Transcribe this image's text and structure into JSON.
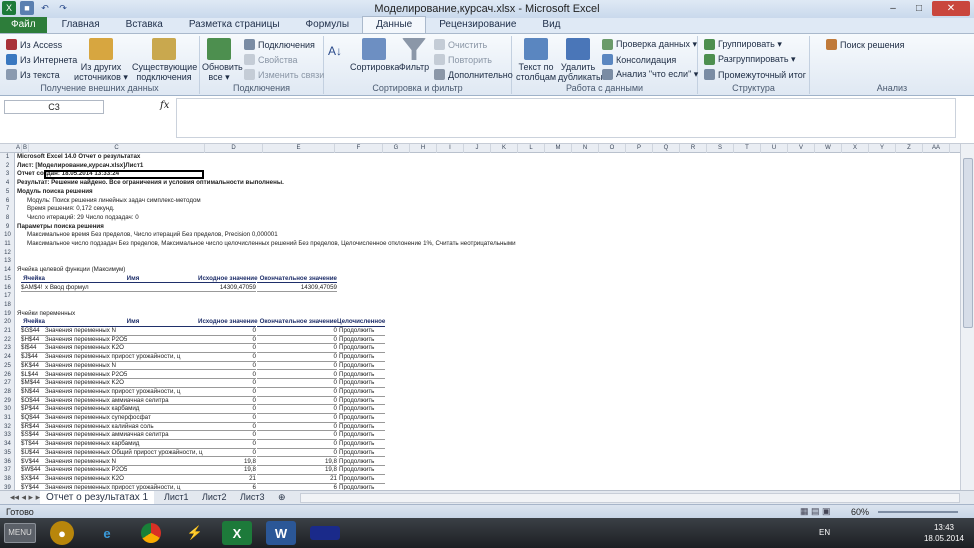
{
  "window": {
    "title": "Моделирование,курсач.xlsx  -  Microsoft Excel",
    "minimize": "–",
    "maximize": "□",
    "close": "✕"
  },
  "tabs": [
    "Файл",
    "Главная",
    "Вставка",
    "Разметка страницы",
    "Формулы",
    "Данные",
    "Рецензирование",
    "Вид"
  ],
  "ribbon": {
    "ext": {
      "access": "Из Access",
      "web": "Из Интернета",
      "text": "Из текста",
      "other": "Из других источников ▾",
      "existing": "Существующие подключения",
      "label": "Получение внешних данных"
    },
    "conn": {
      "refresh": "Обновить все ▾",
      "connections": "Подключения",
      "properties": "Свойства",
      "editlinks": "Изменить связи",
      "label": "Подключения"
    },
    "sort": {
      "az": "Сортировка",
      "filter": "Фильтр",
      "clear": "Очистить",
      "reapply": "Повторить",
      "advanced": "Дополнительно",
      "label": "Сортировка и фильтр"
    },
    "data": {
      "t2c": "Текст по столбцам",
      "dup": "Удалить дубликаты",
      "validate": "Проверка данных ▾",
      "consolidate": "Консолидация",
      "whatif": "Анализ \"что если\" ▾",
      "label": "Работа с данными"
    },
    "outline": {
      "group": "Группировать ▾",
      "ungroup": "Разгруппировать ▾",
      "subtotal": "Промежуточный итог",
      "label": "Структура"
    },
    "analysis": {
      "solver": "Поиск решения",
      "label": "Анализ"
    }
  },
  "formula_bar": {
    "name_box": "C3",
    "fx": "fx",
    "content": ""
  },
  "columns": [
    "A",
    "B",
    "C",
    "D",
    "E",
    "F",
    "G",
    "H",
    "I",
    "J",
    "K",
    "L",
    "M",
    "N",
    "O",
    "P",
    "Q",
    "R",
    "S",
    "T",
    "U",
    "V",
    "W",
    "X",
    "Y",
    "Z",
    "AA"
  ],
  "rows": [
    {
      "n": "1",
      "a": "Microsoft Excel 14.0 Отчет о результатах",
      "bold": true
    },
    {
      "n": "2",
      "a": "Лист: [Моделирование,курсач.xlsx]Лист1",
      "bold": true
    },
    {
      "n": "3",
      "a": "Отчет создан: 18.05.2014 13:33:24",
      "bold": true
    },
    {
      "n": "4",
      "a": "Результат: Решение найдено. Все ограничения и условия оптимальности выполнены.",
      "bold": true
    },
    {
      "n": "5",
      "a": "Модуль поиска решения",
      "bold": true
    },
    {
      "n": "6",
      "b": "Модуль: Поиск решения линейных задач симплекс-методом"
    },
    {
      "n": "7",
      "b": "Время решения: 0,172 секунд."
    },
    {
      "n": "8",
      "b": "Число итераций: 29 Число подзадач: 0"
    },
    {
      "n": "9",
      "a": "Параметры поиска решения",
      "bold": true
    },
    {
      "n": "10",
      "b": "Максимальное время Без пределов,  Число итераций Без пределов, Precision 0,000001"
    },
    {
      "n": "11",
      "b": "Максимальное число подзадач Без пределов, Максимальное число целочисленных решений Без пределов, Целочисленное отклонение 1%, Считать неотрицательными"
    },
    {
      "n": "12"
    },
    {
      "n": "13"
    },
    {
      "n": "14",
      "a": "Ячейка целевой функции (Максимум)"
    },
    {
      "n": "15",
      "hdr": [
        "Ячейка",
        "Имя",
        "Исходное значение",
        "Окончательное значение"
      ]
    },
    {
      "n": "16",
      "cell": "$AM$4!",
      "name": "х Ввод формул",
      "d": "14309,47059",
      "e": "14309,47059"
    },
    {
      "n": "17"
    },
    {
      "n": "18"
    },
    {
      "n": "19",
      "a": "Ячейки переменных"
    },
    {
      "n": "20",
      "hdr": [
        "Ячейка",
        "Имя",
        "Исходное значение",
        "Окончательное значение",
        "Целочисленное"
      ]
    },
    {
      "n": "21",
      "cell": "$G$44",
      "name": "Значения переменных N",
      "d": "0",
      "e": "0",
      "f": "Продолжить"
    },
    {
      "n": "22",
      "cell": "$H$44",
      "name": "Значения переменных P2O5",
      "d": "0",
      "e": "0",
      "f": "Продолжить"
    },
    {
      "n": "23",
      "cell": "$I$44",
      "name": "Значения переменных K2O",
      "d": "0",
      "e": "0",
      "f": "Продолжить"
    },
    {
      "n": "24",
      "cell": "$J$44",
      "name": "Значения переменных прирост урожайности, ц",
      "d": "0",
      "e": "0",
      "f": "Продолжить"
    },
    {
      "n": "25",
      "cell": "$K$44",
      "name": "Значения переменных N",
      "d": "0",
      "e": "0",
      "f": "Продолжить"
    },
    {
      "n": "26",
      "cell": "$L$44",
      "name": "Значения переменных P2O5",
      "d": "0",
      "e": "0",
      "f": "Продолжить"
    },
    {
      "n": "27",
      "cell": "$M$44",
      "name": "Значения переменных K2O",
      "d": "0",
      "e": "0",
      "f": "Продолжить"
    },
    {
      "n": "28",
      "cell": "$N$44",
      "name": "Значения переменных прирост урожайности, ц",
      "d": "0",
      "e": "0",
      "f": "Продолжить"
    },
    {
      "n": "29",
      "cell": "$O$44",
      "name": "Значения переменных аммиачная селитра",
      "d": "0",
      "e": "0",
      "f": "Продолжить"
    },
    {
      "n": "30",
      "cell": "$P$44",
      "name": "Значения переменных карбамид",
      "d": "0",
      "e": "0",
      "f": "Продолжить"
    },
    {
      "n": "31",
      "cell": "$Q$44",
      "name": "Значения переменных суперфосфат",
      "d": "0",
      "e": "0",
      "f": "Продолжить"
    },
    {
      "n": "32",
      "cell": "$R$44",
      "name": "Значения переменных калийная соль",
      "d": "0",
      "e": "0",
      "f": "Продолжить"
    },
    {
      "n": "33",
      "cell": "$S$44",
      "name": "Значения переменных аммиачная селитра",
      "d": "0",
      "e": "0",
      "f": "Продолжить"
    },
    {
      "n": "34",
      "cell": "$T$44",
      "name": "Значения переменных карбамид",
      "d": "0",
      "e": "0",
      "f": "Продолжить"
    },
    {
      "n": "35",
      "cell": "$U$44",
      "name": "Значения переменных Общий прирост урожайности, ц",
      "d": "0",
      "e": "0",
      "f": "Продолжить"
    },
    {
      "n": "36",
      "cell": "$V$44",
      "name": "Значения переменных N",
      "d": "19,8",
      "e": "19,8",
      "f": "Продолжить"
    },
    {
      "n": "37",
      "cell": "$W$44",
      "name": "Значения переменных P2O5",
      "d": "19,8",
      "e": "19,8",
      "f": "Продолжить"
    },
    {
      "n": "38",
      "cell": "$X$44",
      "name": "Значения переменных K2O",
      "d": "21",
      "e": "21",
      "f": "Продолжить"
    },
    {
      "n": "39",
      "cell": "$Y$44",
      "name": "Значения переменных прирост урожайности, ц",
      "d": "6",
      "e": "6",
      "f": "Продолжить"
    }
  ],
  "sheet_tabs": [
    "Отчет о результатах 1",
    "Лист1",
    "Лист2",
    "Лист3"
  ],
  "status": {
    "ready": "Готово",
    "zoom": "60%"
  },
  "taskbar": {
    "start": "MENU",
    "lang": "EN",
    "time": "13:43",
    "date": "18.05.2014"
  },
  "colors": {
    "file_tab": "#2d7d3a",
    "excel_green": "#1d7a3a",
    "header_blue": "#1f2f6a"
  }
}
